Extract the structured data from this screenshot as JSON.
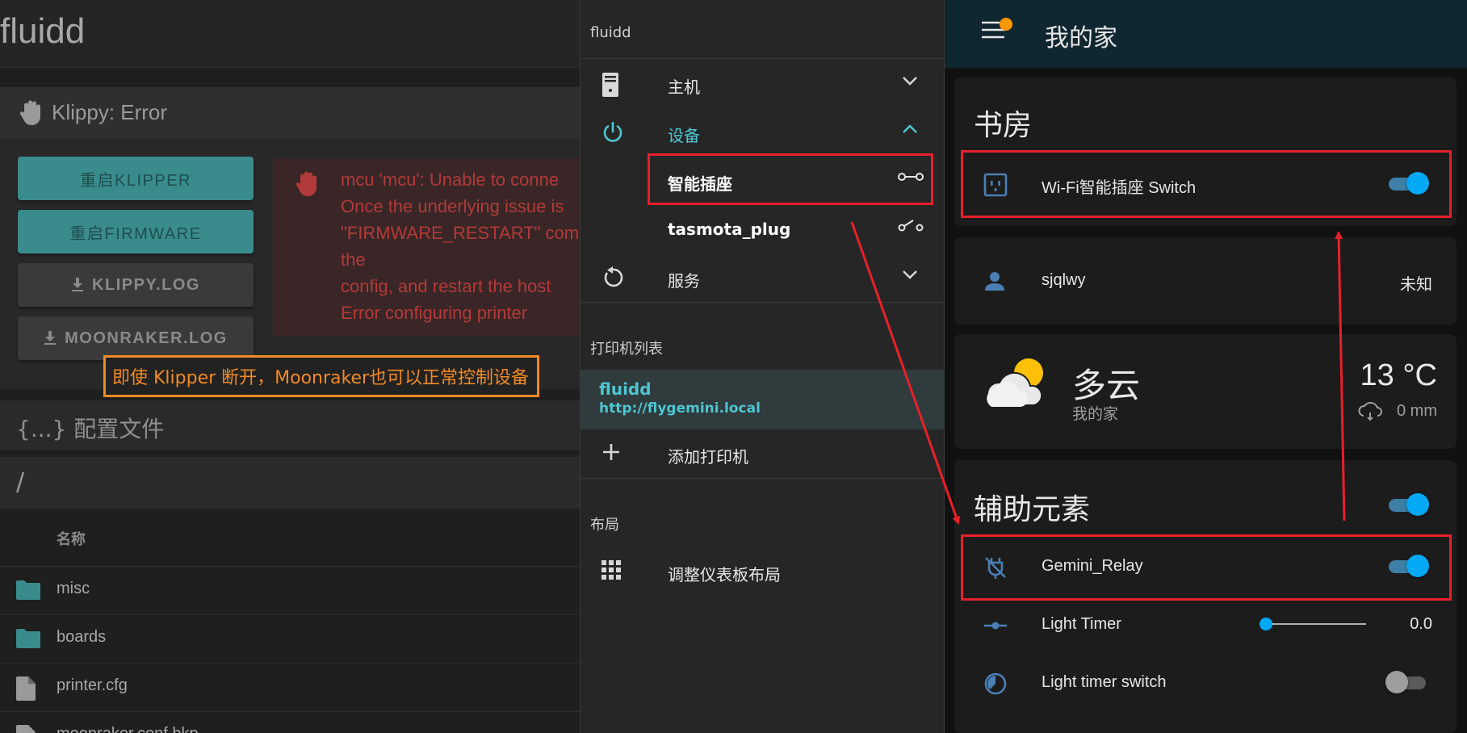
{
  "left": {
    "app_title": "fluidd",
    "klippy_title": "Klippy: Error",
    "buttons": {
      "restart_klipper": "重启KLIPPER",
      "restart_firmware": "重启FIRMWARE",
      "klippy_log": "KLIPPY.LOG",
      "moonraker_log": "MOONRAKER.LOG"
    },
    "error_lines": [
      "mcu 'mcu': Unable to conne",
      "Once the underlying issue is",
      "\"FIRMWARE_RESTART\" com",
      "the",
      "config, and restart the host",
      "Error configuring printer"
    ],
    "callout": "即使 Klipper 断开，Moonraker也可以正常控制设备",
    "config_title": "{...} 配置文件",
    "path": "/",
    "column_name": "名称",
    "files": [
      {
        "name": "misc",
        "icon": "folder-icon"
      },
      {
        "name": "boards",
        "icon": "folder-icon"
      },
      {
        "name": "printer.cfg",
        "icon": "file-icon"
      },
      {
        "name": "moonraker.conf.bkp",
        "icon": "file-icon"
      }
    ]
  },
  "mid": {
    "title": "fluidd",
    "host_label": "主机",
    "devices_label": "设备",
    "smart_plug_label": "智能插座",
    "tasmota_label": "tasmota_plug",
    "services_label": "服务",
    "printers_section": "打印机列表",
    "printer_name": "fluidd",
    "printer_url": "http://flygemini.local",
    "add_printer": "添加打印机",
    "layout_section": "布局",
    "adjust_layout": "调整仪表板布局",
    "accent_color": "#4ec6d1"
  },
  "right": {
    "title": "我的家",
    "study_title": "书房",
    "wifi_plug_label": "Wi-Fi智能插座 Switch",
    "wifi_plug_on": true,
    "person_name": "sjqlwy",
    "person_state": "未知",
    "weather_condition": "多云",
    "weather_location": "我的家",
    "temperature": "13 °C",
    "precipitation": "0 mm",
    "helpers_title": "辅助元素",
    "helpers_toggle_on": true,
    "relay_label": "Gemini_Relay",
    "relay_on": true,
    "light_timer_label": "Light Timer",
    "light_timer_value": "0.0",
    "light_timer_switch_label": "Light timer switch",
    "light_timer_switch_on": false,
    "accent_color": "#03a9f4",
    "notification_color": "#ff9800"
  },
  "annotations": {
    "highlight_color": "#e8202a",
    "callout_color": "#f08a24"
  }
}
